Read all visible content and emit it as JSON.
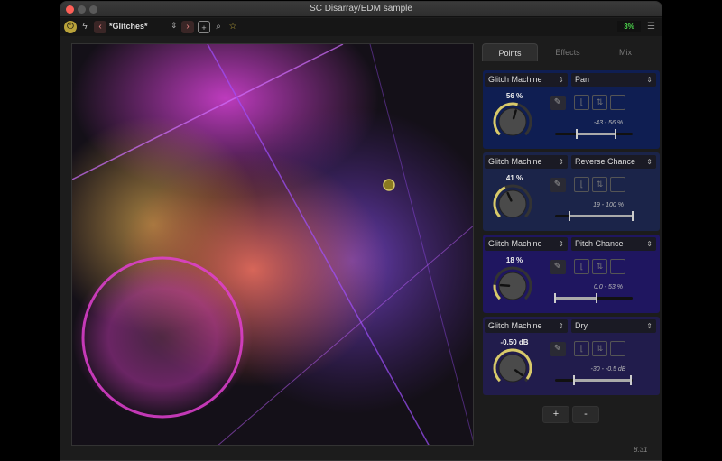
{
  "window": {
    "title": "SC Disarray/EDM sample"
  },
  "toolbar": {
    "preset_name": "*Glitches*",
    "cpu": "3%",
    "icons": [
      "power-icon",
      "bolt-icon",
      "chevron-left-icon",
      "chevron-right-icon",
      "save-icon",
      "search-icon",
      "star-icon",
      "menu-icon"
    ]
  },
  "tabs": [
    {
      "label": "Points",
      "active": true
    },
    {
      "label": "Effects",
      "active": false
    },
    {
      "label": "Mix",
      "active": false
    }
  ],
  "panels": [
    {
      "source": "Glitch Machine",
      "param": "Pan",
      "value": "56 %",
      "range": "-43 - 56 %",
      "level": 0.56,
      "range_min_frac": 0.28,
      "range_max_frac": 0.78,
      "color": "#0f1e52"
    },
    {
      "source": "Glitch Machine",
      "param": "Reverse Chance",
      "value": "41 %",
      "range": "19 - 100 %",
      "level": 0.41,
      "range_min_frac": 0.19,
      "range_max_frac": 1.0,
      "color": "#1b2449"
    },
    {
      "source": "Glitch Machine",
      "param": "Pitch Chance",
      "value": "18 %",
      "range": "0.0 - 53 %",
      "level": 0.18,
      "range_min_frac": 0.0,
      "range_max_frac": 0.53,
      "color": "#1f1660"
    },
    {
      "source": "Glitch Machine",
      "param": "Dry",
      "value": "-0.50 dB",
      "range": "-30 - -0.5 dB",
      "level": 0.97,
      "range_min_frac": 0.24,
      "range_max_frac": 0.98,
      "color": "#211c4c"
    }
  ],
  "buttons": {
    "add": "+",
    "remove": "-"
  },
  "version": "8.31",
  "colors": {
    "accent": "#d8c96a",
    "cpu_text": "#4cd44c"
  }
}
